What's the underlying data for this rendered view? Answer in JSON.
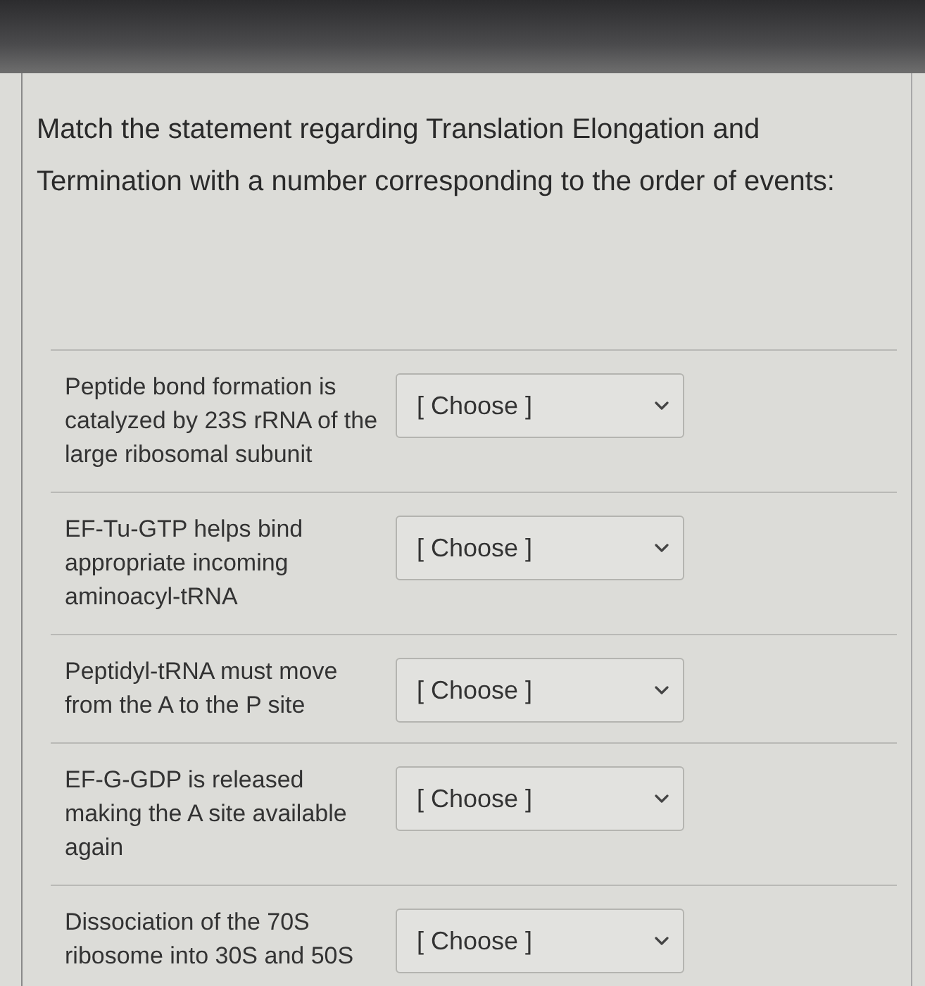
{
  "question": {
    "prompt": "Match the statement regarding Translation Elongation and Termination with a number corresponding to the order of events:"
  },
  "matches": [
    {
      "statement": "Peptide bond formation is catalyzed by 23S rRNA of the large ribosomal subunit",
      "dropdown": {
        "value": "[ Choose ]"
      }
    },
    {
      "statement": "EF-Tu-GTP helps bind appropriate incoming aminoacyl-tRNA",
      "dropdown": {
        "value": "[ Choose ]"
      }
    },
    {
      "statement": "Peptidyl-tRNA must move from the A to the P site",
      "dropdown": {
        "value": "[ Choose ]"
      }
    },
    {
      "statement": "EF-G-GDP is released making the A site available again",
      "dropdown": {
        "value": "[ Choose ]"
      }
    },
    {
      "statement": "Dissociation of the 70S ribosome into 30S and 50S",
      "dropdown": {
        "value": "[ Choose ]"
      }
    }
  ]
}
